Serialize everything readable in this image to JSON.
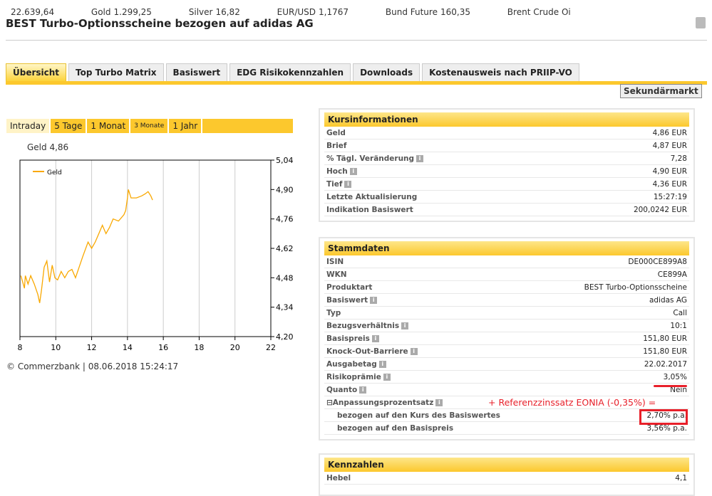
{
  "ticker": [
    {
      "label": "",
      "value": "22.639,64"
    },
    {
      "label": "Gold",
      "value": "1.299,25"
    },
    {
      "label": "Silver",
      "value": "16,82"
    },
    {
      "label": "EUR/USD",
      "value": "1,1767"
    },
    {
      "label": "Bund Future",
      "value": "160,35"
    },
    {
      "label": "Brent Crude Oi",
      "value": ""
    }
  ],
  "title": "BEST Turbo-Optionsscheine bezogen auf adidas AG",
  "tabs": [
    "Übersicht",
    "Top Turbo Matrix",
    "Basiswert",
    "EDG Risikokennzahlen",
    "Downloads",
    "Kostenausweis nach PRIIP-VO"
  ],
  "secondary_button": "Sekundärmarkt",
  "chart_tabs": [
    "Intraday",
    "5 Tage",
    "1 Monat",
    "3 Monate",
    "1 Jahr"
  ],
  "chart_header": "Geld 4,86",
  "copyright": "© Commerzbank | 08.06.2018 15:24:17",
  "chart_data": {
    "type": "line",
    "title": "Geld 4,86",
    "legend": [
      "Geld"
    ],
    "legend_position": "top-left",
    "xlim": [
      8,
      22
    ],
    "ylim": [
      4.2,
      5.04
    ],
    "xticks": [
      "8",
      "10",
      "12",
      "14",
      "16",
      "18",
      "20",
      "22"
    ],
    "yticks": [
      "5,04",
      "4,90",
      "4,76",
      "4,62",
      "4,48",
      "4,34",
      "4,20"
    ],
    "series": [
      {
        "name": "Geld",
        "color": "#f9a800",
        "x": [
          8.05,
          8.15,
          8.25,
          8.3,
          8.45,
          8.6,
          8.8,
          9.0,
          9.1,
          9.2,
          9.35,
          9.5,
          9.65,
          9.8,
          9.95,
          10.1,
          10.3,
          10.5,
          10.7,
          10.9,
          11.1,
          11.3,
          11.5,
          11.8,
          12.0,
          12.2,
          12.4,
          12.6,
          12.8,
          13.0,
          13.2,
          13.5,
          13.8,
          13.9,
          14.0,
          14.05,
          14.2,
          14.5,
          14.8,
          15.0,
          15.15,
          15.3,
          15.4
        ],
        "y": [
          4.49,
          4.46,
          4.43,
          4.49,
          4.45,
          4.49,
          4.45,
          4.4,
          4.36,
          4.42,
          4.53,
          4.56,
          4.46,
          4.54,
          4.48,
          4.47,
          4.51,
          4.48,
          4.51,
          4.52,
          4.48,
          4.53,
          4.58,
          4.65,
          4.62,
          4.65,
          4.69,
          4.73,
          4.69,
          4.72,
          4.76,
          4.75,
          4.78,
          4.8,
          4.86,
          4.9,
          4.86,
          4.86,
          4.87,
          4.88,
          4.89,
          4.87,
          4.85
        ]
      }
    ]
  },
  "kurs": {
    "title": "Kursinformationen",
    "rows": [
      {
        "l": "Geld",
        "v": "4,86 EUR"
      },
      {
        "l": "Brief",
        "v": "4,87 EUR"
      },
      {
        "l": "% Tägl. Veränderung",
        "v": "7,28",
        "i": true
      },
      {
        "l": "Hoch",
        "v": "4,90 EUR",
        "i": true
      },
      {
        "l": "Tief",
        "v": "4,36 EUR",
        "i": true
      },
      {
        "l": "Letzte Aktualisierung",
        "v": "15:27:19"
      },
      {
        "l": "Indikation Basiswert",
        "v": "200,0242 EUR"
      }
    ]
  },
  "stamm": {
    "title": "Stammdaten",
    "rows": [
      {
        "l": "ISIN",
        "v": "DE000CE899A8"
      },
      {
        "l": "WKN",
        "v": "CE899A"
      },
      {
        "l": "Produktart",
        "v": "BEST Turbo-Optionsscheine"
      },
      {
        "l": "Basiswert",
        "v": "adidas AG",
        "i": true
      },
      {
        "l": "Typ",
        "v": "Call"
      },
      {
        "l": "Bezugsverhältnis",
        "v": "10:1",
        "i": true
      },
      {
        "l": "Basispreis",
        "v": "151,80 EUR",
        "i": true
      },
      {
        "l": "Knock-Out-Barriere",
        "v": "151,80 EUR",
        "i": true
      },
      {
        "l": "Ausgabetag",
        "v": "22.02.2017",
        "i": true
      },
      {
        "l": "Risikoprämie",
        "v": "3,05%",
        "i": true
      },
      {
        "l": "Quanto",
        "v": "Nein",
        "i": true
      },
      {
        "l": "⊟Anpassungsprozentsatz",
        "v": "",
        "i": true
      },
      {
        "l": "bezogen auf den Kurs des Basiswertes",
        "v": "2,70% p.a.",
        "sub": true
      },
      {
        "l": "bezogen auf den Basispreis",
        "v": "3,56% p.a.",
        "sub": true
      }
    ]
  },
  "kenn": {
    "title": "Kennzahlen",
    "rows": [
      {
        "l": "Hebel",
        "v": "4,1"
      }
    ]
  },
  "annotation": "+ Referenzzinssatz EONIA (-0,35%) ="
}
